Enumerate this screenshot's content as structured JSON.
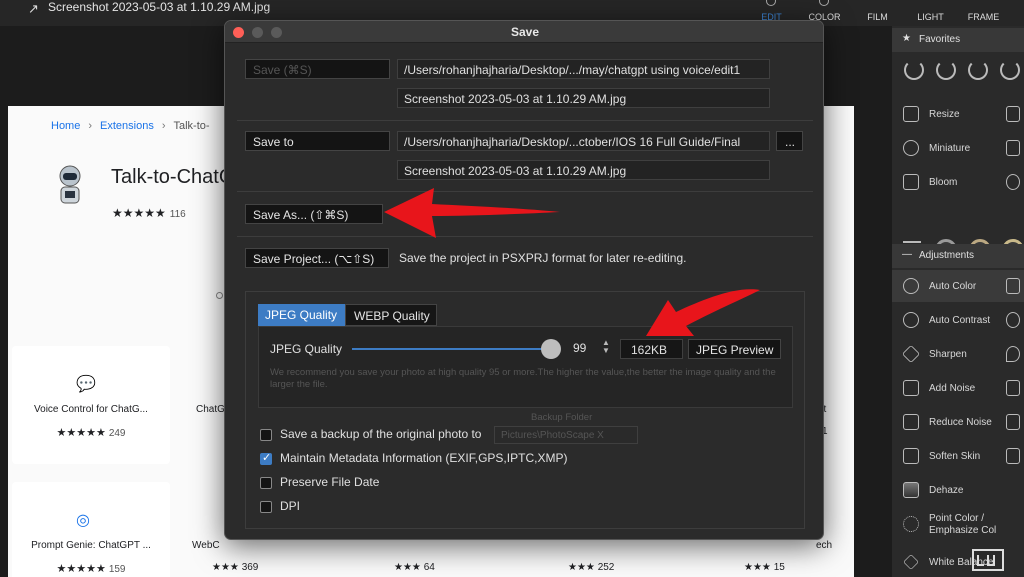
{
  "app": {
    "title": "Screenshot 2023-05-03 at 1.10.29 AM.jpg",
    "tabs": [
      "EDIT",
      "COLOR",
      "FILM",
      "LIGHT",
      "FRAME"
    ]
  },
  "browser": {
    "breadcrumb": [
      "Home",
      "Extensions",
      "Talk-to-"
    ],
    "ext_title": "Talk-to-ChatG",
    "ext_rating_stars": "★★★★★",
    "ext_rating_count": "116",
    "cards": [
      {
        "title": "Voice Control for ChatG...",
        "stars": "★★★★★",
        "count": "249"
      },
      {
        "title": "Prompt Genie: ChatGPT ...",
        "stars": "★★★★★",
        "count": "159"
      }
    ],
    "fragments": {
      "chat": "ChatG",
      "webc": "WebC",
      "n369": "369",
      "n64": "64",
      "n252": "252",
      "n15": "15",
      "n1": "1",
      "pt": "pt",
      "ech": "ech"
    }
  },
  "right_panel": {
    "favorites": "Favorites",
    "items_top": [
      "Resize",
      "Miniature",
      "Bloom"
    ],
    "adjustments": "Adjustments",
    "items_adj": [
      "Auto Color",
      "Auto Contrast",
      "Sharpen",
      "Add Noise",
      "Reduce Noise",
      "Soften Skin",
      "Dehaze",
      "Point Color / Emphasize Col",
      "White Balance"
    ]
  },
  "dialog": {
    "title": "Save",
    "save_label": "Save    (⌘S)",
    "save_path": "/Users/rohanjhajharia/Desktop/.../may/chatgpt using voice/edit1",
    "save_file": "Screenshot 2023-05-03 at 1.10.29 AM.jpg",
    "saveto_label": "Save to",
    "saveto_path": "/Users/rohanjhajharia/Desktop/...ctober/IOS 16 Full Guide/Final",
    "saveto_browse": "...",
    "saveto_file": "Screenshot 2023-05-03 at 1.10.29 AM.jpg",
    "saveas_label": "Save As...  (⇧⌘S)",
    "project_label": "Save Project...  (⌥⇧S)",
    "project_desc": "Save the project in PSXPRJ format for later re-editing.",
    "tab_jpeg": "JPEG Quality",
    "tab_webp": "WEBP Quality",
    "quality_label": "JPEG Quality",
    "quality_value": "99",
    "quality_max": 100,
    "file_size": "162KB",
    "preview_button": "JPEG Preview",
    "hint": "We recommend you save your photo at high quality 95 or more.The higher the value,the better the image quality and the larger the file.",
    "backup_folder_label": "Backup Folder",
    "backup_folder_value": "Pictures\\PhotoScape X",
    "opt_backup": "Save a backup of the original photo to",
    "opt_metadata": "Maintain Metadata Information (EXIF,GPS,IPTC,XMP)",
    "opt_filedate": "Preserve File Date",
    "opt_dpi": "DPI",
    "metadata_checked": true
  },
  "colors": {
    "accent": "#3d7cc4",
    "annotation": "#e8151b"
  }
}
